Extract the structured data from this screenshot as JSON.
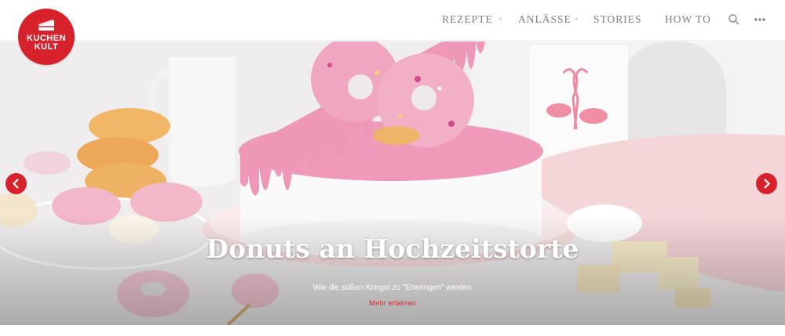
{
  "brand": {
    "logo_line1": "KUCHEN",
    "logo_line2": "KULT",
    "color": "#d7222b"
  },
  "nav": {
    "items": [
      {
        "label": "REZEPTE",
        "has_dropdown": true
      },
      {
        "label": "ANLÄSSE",
        "has_dropdown": true
      },
      {
        "label": "STORIES",
        "has_dropdown": false
      },
      {
        "label": "HOW TO",
        "has_dropdown": false
      }
    ],
    "icons": [
      "search-icon",
      "more-icon"
    ]
  },
  "slider": {
    "title": "Donuts an Hochzeitstorte",
    "subtitle": "Wie die süßen Kringel zu \"Eheringen\" werden",
    "link_label": "Mehr erfahren",
    "link_color": "#e5262e",
    "arrow_color": "#d7222b",
    "prev_icon": "chevron-left-icon",
    "next_icon": "chevron-right-icon"
  }
}
